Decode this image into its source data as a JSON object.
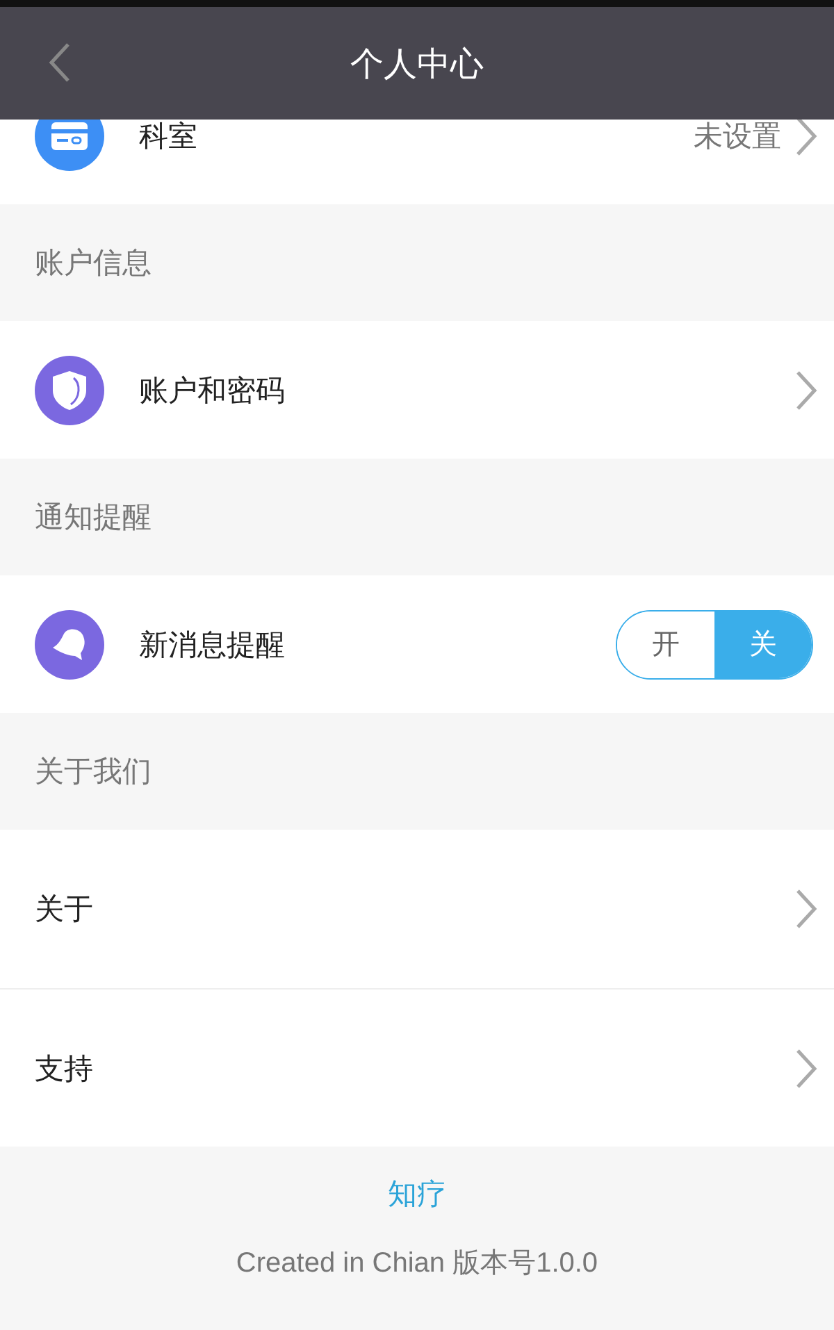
{
  "header": {
    "title": "个人中心"
  },
  "sections": [
    {
      "rows": [
        {
          "kind": "value",
          "label": "科室",
          "value": "未设置"
        }
      ]
    },
    {
      "title": "账户信息",
      "rows": [
        {
          "kind": "link",
          "label": "账户和密码"
        }
      ]
    },
    {
      "title": "通知提醒",
      "rows": [
        {
          "kind": "toggle",
          "label": "新消息提醒",
          "options": [
            {
              "label": "开",
              "selected": false
            },
            {
              "label": "关",
              "selected": true
            }
          ]
        }
      ]
    },
    {
      "title": "关于我们",
      "rows": [
        {
          "kind": "link",
          "label": "关于"
        },
        {
          "kind": "link",
          "label": "支持"
        }
      ]
    }
  ],
  "footer": {
    "brand": "知疗",
    "version": "Created in Chian 版本号1.0.0"
  }
}
